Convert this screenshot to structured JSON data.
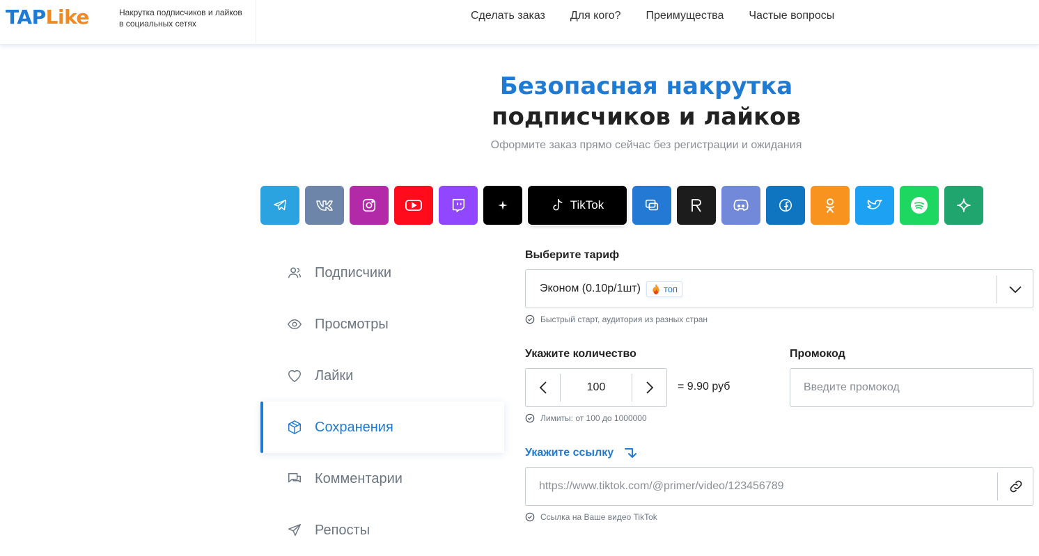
{
  "header": {
    "logo_part1": "TAP",
    "logo_part2": "Like",
    "tagline": "Накрутка подписчиков и лайков в социальных сетях",
    "nav": [
      "Сделать заказ",
      "Для кого?",
      "Преимущества",
      "Частые вопросы"
    ]
  },
  "hero": {
    "title_line1": "Безопасная накрутка",
    "title_line2": "подписчиков и лайков",
    "subtitle": "Оформите заказ прямо сейчас без регистрации и ожидания"
  },
  "platforms": {
    "active_label": "TikTok",
    "colors": {
      "telegram": "#2aa3e0",
      "vk": "#6d85a8",
      "instagram": "#b32aa8",
      "youtube": "#ff0b1b",
      "twitch": "#9147ff",
      "threads": "#000000",
      "tiktok": "#000000",
      "yappy": "#2379d4",
      "rutube": "#1c1c1c",
      "discord": "#7289da",
      "facebook": "#1075c1",
      "odnoklassniki": "#f7931e",
      "twitter": "#1da1f2",
      "spotify": "#1ed760",
      "dzen": "#20a56e"
    }
  },
  "menu": {
    "items": [
      "Подписчики",
      "Просмотры",
      "Лайки",
      "Сохранения",
      "Комментарии",
      "Репосты"
    ],
    "active": "Сохранения"
  },
  "form": {
    "tariff_label": "Выберите тариф",
    "tariff_value": "Эконом (0.10р/1шт)",
    "tariff_badge": "топ",
    "tariff_hint": "Быстрый старт, аудитория из разных стран",
    "quantity_label": "Укажите количество",
    "quantity_value": "100",
    "price": "= 9.90 руб",
    "quantity_hint": "Лимиты: от 100 до 1000000",
    "promo_label": "Промокод",
    "promo_placeholder": "Введите промокод",
    "link_label": "Укажите ссылку",
    "link_placeholder": "https://www.tiktok.com/@primer/video/123456789",
    "link_hint": "Ссылка на Ваше видео TikTok"
  }
}
